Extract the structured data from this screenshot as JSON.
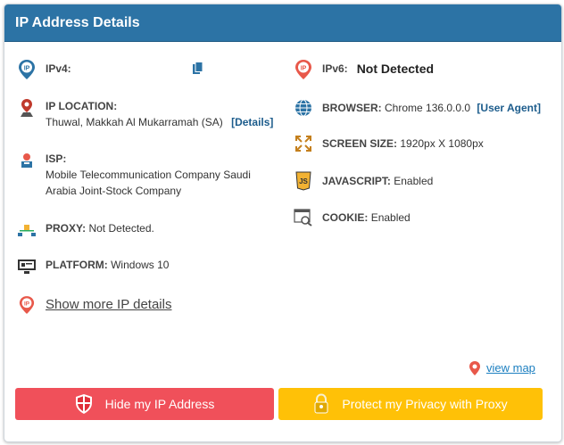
{
  "header": {
    "title": "IP Address Details"
  },
  "ipv4": {
    "label": "IPv4:"
  },
  "ipv6": {
    "label": "IPv6:",
    "value": "Not Detected"
  },
  "location": {
    "label": "IP LOCATION:",
    "value": "Thuwal, Makkah Al Mukarramah (SA)",
    "details_link": "[Details]"
  },
  "isp": {
    "label": "ISP:",
    "line1": "Mobile Telecommunication Company Saudi",
    "line2": "Arabia Joint-Stock Company"
  },
  "proxy": {
    "label": "PROXY:",
    "value": "Not Detected."
  },
  "platform": {
    "label": "PLATFORM:",
    "value": "Windows 10"
  },
  "show_more": {
    "label": "Show more IP details"
  },
  "browser": {
    "label": "BROWSER:",
    "value": "Chrome 136.0.0.0",
    "ua_link": "[User Agent]"
  },
  "screen": {
    "label": "SCREEN SIZE:",
    "value": "1920px X 1080px"
  },
  "javascript": {
    "label": "JAVASCRIPT:",
    "value": "Enabled"
  },
  "cookie": {
    "label": "COOKIE:",
    "value": "Enabled"
  },
  "view_map": {
    "label": "view map"
  },
  "buttons": {
    "hide_ip": "Hide my IP Address",
    "protect": "Protect my Privacy with Proxy"
  },
  "colors": {
    "header": "#2c73a5",
    "hide_button": "#f0505a",
    "protect_button": "#ffc107",
    "link": "#1c5c8c"
  }
}
